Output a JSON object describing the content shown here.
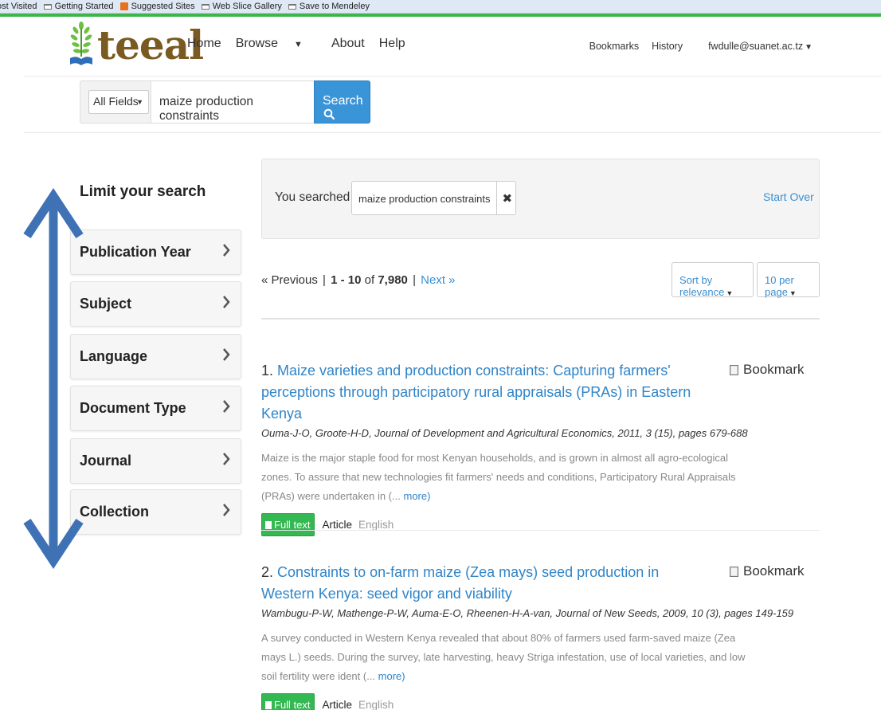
{
  "browser": {
    "bookmarks": [
      "ost Visited",
      "Getting Started",
      "Suggested Sites",
      "Web Slice Gallery",
      "Save to Mendeley"
    ]
  },
  "header": {
    "logo_text": "teeal",
    "nav": {
      "home": "Home",
      "browse": "Browse",
      "about": "About",
      "help": "Help"
    },
    "right_nav": {
      "bookmarks": "Bookmarks",
      "history": "History",
      "user": "fwdulle@suanet.ac.tz"
    }
  },
  "search": {
    "field_select": "All Fields",
    "query": "maize production constraints",
    "button_label": "Search"
  },
  "sidebar": {
    "title": "Limit your search",
    "facets": [
      "Publication Year",
      "Subject",
      "Language",
      "Document Type",
      "Journal",
      "Collection"
    ]
  },
  "constraints": {
    "label": "You searched for:",
    "chip": "maize production constraints",
    "remove": "✖",
    "start_over": "Start Over"
  },
  "pagination": {
    "previous": "« Previous",
    "separator": "|",
    "range": "1 - 10",
    "of_text": "of",
    "total": "7,980",
    "next": "Next »",
    "sort": "Sort by relevance",
    "per_page": "10 per page"
  },
  "results": [
    {
      "num": "1.",
      "title": "Maize varieties and production constraints: Capturing farmers' perceptions through participatory rural appraisals (PRAs) in Eastern Kenya",
      "authors": "Ouma-J-O, Groote-H-D, Journal of Development and Agricultural Economics, 2011, 3 (15), pages 679-688",
      "abstract": "Maize is the major staple food for most Kenyan households, and is grown in almost all agro-ecological zones. To assure that new technologies fit farmers' needs and conditions, Participatory Rural Appraisals (PRAs) were undertaken in (...",
      "more": "more)",
      "bookmark": "Bookmark",
      "fulltext": "Full text",
      "type": "Article",
      "language": "English"
    },
    {
      "num": "2.",
      "title": "Constraints to on-farm maize (Zea mays) seed production in Western Kenya: seed vigor and viability",
      "authors": "Wambugu-P-W, Mathenge-P-W, Auma-E-O, Rheenen-H-A-van, Journal of New Seeds, 2009, 10 (3), pages 149-159",
      "abstract": "A survey conducted in Western Kenya revealed that about 80% of farmers used farm-saved maize (Zea mays L.) seeds. During the survey, late harvesting, heavy Striga infestation, use of local varieties, and low soil fertility were ident (...",
      "more": "more)",
      "bookmark": "Bookmark",
      "fulltext": "Full text",
      "type": "Article",
      "language": "English"
    }
  ]
}
